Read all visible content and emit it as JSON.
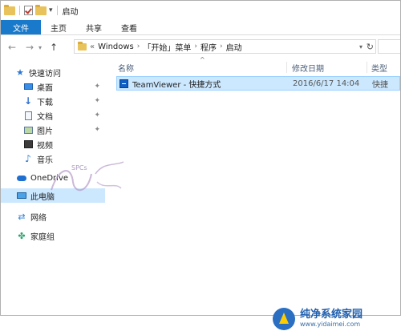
{
  "window": {
    "title": "启动"
  },
  "ribbon": {
    "tabs": [
      {
        "label": "文件",
        "active": true
      },
      {
        "label": "主页"
      },
      {
        "label": "共享"
      },
      {
        "label": "查看"
      }
    ]
  },
  "address": {
    "prefix": "«",
    "crumbs": [
      "Windows",
      "「开始」菜单",
      "程序",
      "启动"
    ],
    "separator": "›"
  },
  "navpane": {
    "quick_access": "快速访问",
    "items": [
      {
        "label": "桌面",
        "icon": "desktop-icon",
        "pinned": true
      },
      {
        "label": "下载",
        "icon": "download-icon",
        "pinned": true
      },
      {
        "label": "文档",
        "icon": "document-icon",
        "pinned": true
      },
      {
        "label": "图片",
        "icon": "picture-icon",
        "pinned": true
      },
      {
        "label": "视频",
        "icon": "video-icon",
        "pinned": false
      },
      {
        "label": "音乐",
        "icon": "music-icon",
        "pinned": false
      }
    ],
    "onedrive": "OneDrive",
    "this_pc": "此电脑",
    "network": "网络",
    "homegroup": "家庭组"
  },
  "content": {
    "columns": {
      "name": "名称",
      "date": "修改日期",
      "type": "类型"
    },
    "rows": [
      {
        "name": "TeamViewer - 快捷方式",
        "date": "2016/6/17 14:04",
        "type": "快捷"
      }
    ]
  },
  "watermark": {
    "left_text": "SPCs",
    "brand": "纯净系统家园",
    "url": "www.yidaimei.com"
  },
  "colors": {
    "file_tab": "#1979ca",
    "selection": "#cce8ff",
    "selection_border": "#99d1ff",
    "header_text": "#4c607a"
  }
}
